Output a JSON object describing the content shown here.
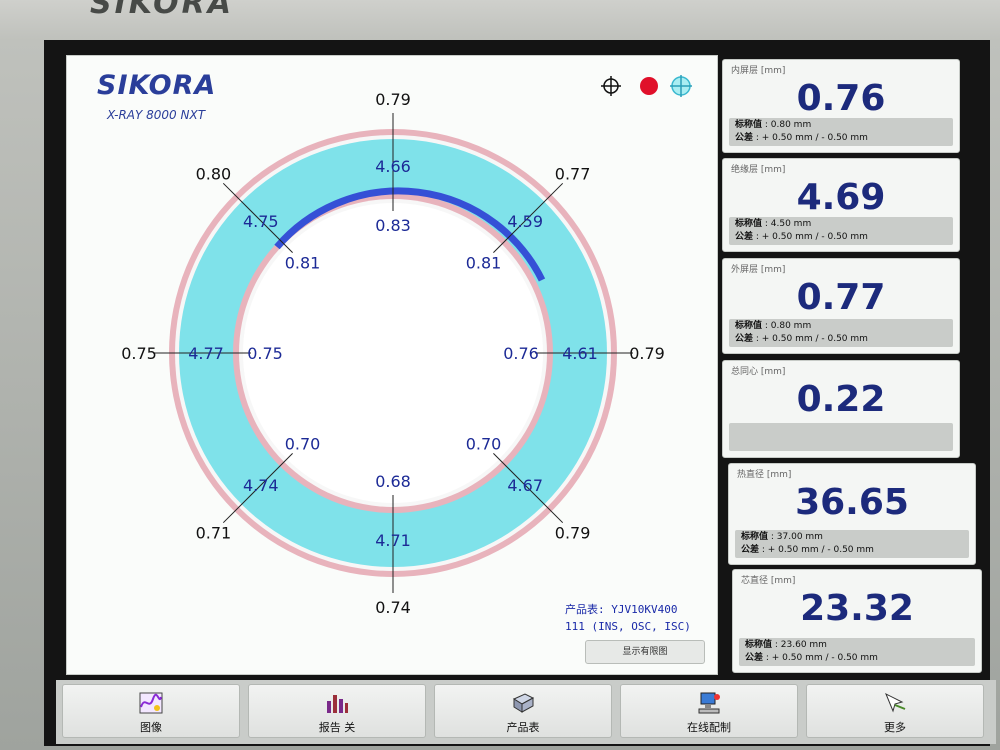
{
  "bezel": {
    "brand": "SIKORA"
  },
  "header": {
    "logo": "SIKORA",
    "subtitle": "X-RAY 8000 NXT"
  },
  "icons": [
    "crosshair-icon",
    "red-dot-icon",
    "cyan-crosshair-icon"
  ],
  "gauge": {
    "outer": [
      "0.79",
      "0.77",
      "0.79",
      "0.79",
      "0.74",
      "0.71",
      "0.75",
      "0.80"
    ],
    "middle": [
      "4.66",
      "4.59",
      "4.61",
      "4.67",
      "4.71",
      "4.74",
      "4.77",
      "4.75"
    ],
    "inner": [
      "0.83",
      "0.81",
      "0.76",
      "0.70",
      "0.68",
      "0.70",
      "0.75",
      "0.81"
    ],
    "colors": {
      "ring": "#e8b3bc",
      "insulation": "#7fe2ea",
      "inner_arc": "#3550d6",
      "text": "#1c2a96"
    }
  },
  "product": {
    "line1": "产品表: YJV10KV400",
    "line2": "111 (INS, OSC, ISC)",
    "show_button": "显示有限图"
  },
  "readouts": [
    {
      "label": "内屏层 [mm]",
      "value": "0.76",
      "nominal_label": "标称值",
      "nominal": ": 0.80 mm",
      "tol_label": "公差",
      "tol": ": + 0.50 mm / - 0.50 mm"
    },
    {
      "label": "绝缘层 [mm]",
      "value": "4.69",
      "nominal_label": "标称值",
      "nominal": ": 4.50 mm",
      "tol_label": "公差",
      "tol": ": + 0.50 mm / - 0.50 mm"
    },
    {
      "label": "外屏层 [mm]",
      "value": "0.77",
      "nominal_label": "标称值",
      "nominal": ": 0.80 mm",
      "tol_label": "公差",
      "tol": ": + 0.50 mm / - 0.50 mm"
    },
    {
      "label": "总同心 [mm]",
      "value": "0.22"
    },
    {
      "label": "热直径 [mm]",
      "value": "36.65",
      "nominal_label": "标称值",
      "nominal": ": 37.00 mm",
      "tol_label": "公差",
      "tol": ": + 0.50 mm / - 0.50 mm"
    },
    {
      "label": "芯直径 [mm]",
      "value": "23.32",
      "nominal_label": "标称值",
      "nominal": ": 23.60 mm",
      "tol_label": "公差",
      "tol": ": + 0.50 mm / - 0.50 mm"
    }
  ],
  "toolbar": [
    {
      "label": "图像",
      "icon": "chart-image-icon"
    },
    {
      "label": "报告 关",
      "icon": "bar-chart-icon"
    },
    {
      "label": "产品表",
      "icon": "database-icon"
    },
    {
      "label": "在线配制",
      "icon": "network-computer-icon"
    },
    {
      "label": "更多",
      "icon": "pointer-hand-icon"
    }
  ]
}
